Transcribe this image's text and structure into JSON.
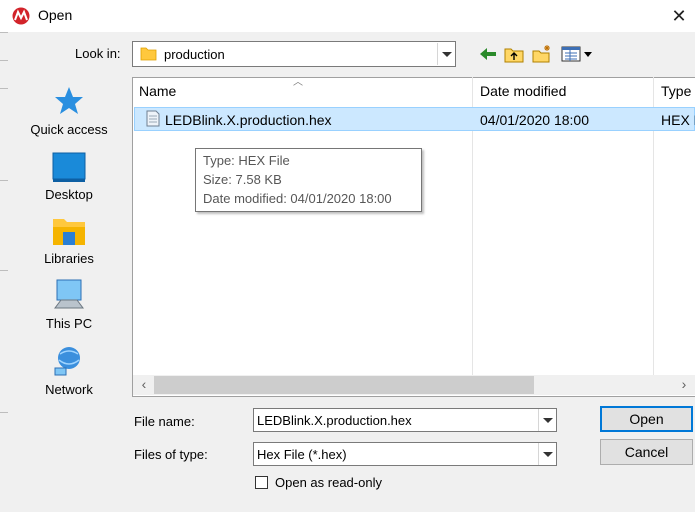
{
  "window": {
    "title": "Open"
  },
  "look_in": {
    "label": "Look in:",
    "value": "production"
  },
  "places": [
    {
      "label": "Quick access",
      "icon": "star-icon"
    },
    {
      "label": "Desktop",
      "icon": "desktop-icon"
    },
    {
      "label": "Libraries",
      "icon": "libraries-icon"
    },
    {
      "label": "This PC",
      "icon": "computer-icon"
    },
    {
      "label": "Network",
      "icon": "network-icon"
    }
  ],
  "columns": {
    "name": "Name",
    "date": "Date modified",
    "type": "Type"
  },
  "files": [
    {
      "name": "LEDBlink.X.production.hex",
      "date": "04/01/2020 18:00",
      "type": "HEX F"
    }
  ],
  "tooltip": {
    "type": "Type: HEX File",
    "size": "Size: 7.58 KB",
    "date": "Date modified: 04/01/2020 18:00"
  },
  "file_name": {
    "label": "File name:",
    "value": "LEDBlink.X.production.hex"
  },
  "files_of_type": {
    "label": "Files of type:",
    "value": "Hex File (*.hex)"
  },
  "buttons": {
    "open": "Open",
    "cancel": "Cancel"
  },
  "readonly": {
    "label": "Open as read-only",
    "checked": false
  },
  "colors": {
    "selection": "#cce8ff",
    "selection_border": "#99d1ff",
    "accent": "#0078d7",
    "folder": "#ffc83d"
  }
}
